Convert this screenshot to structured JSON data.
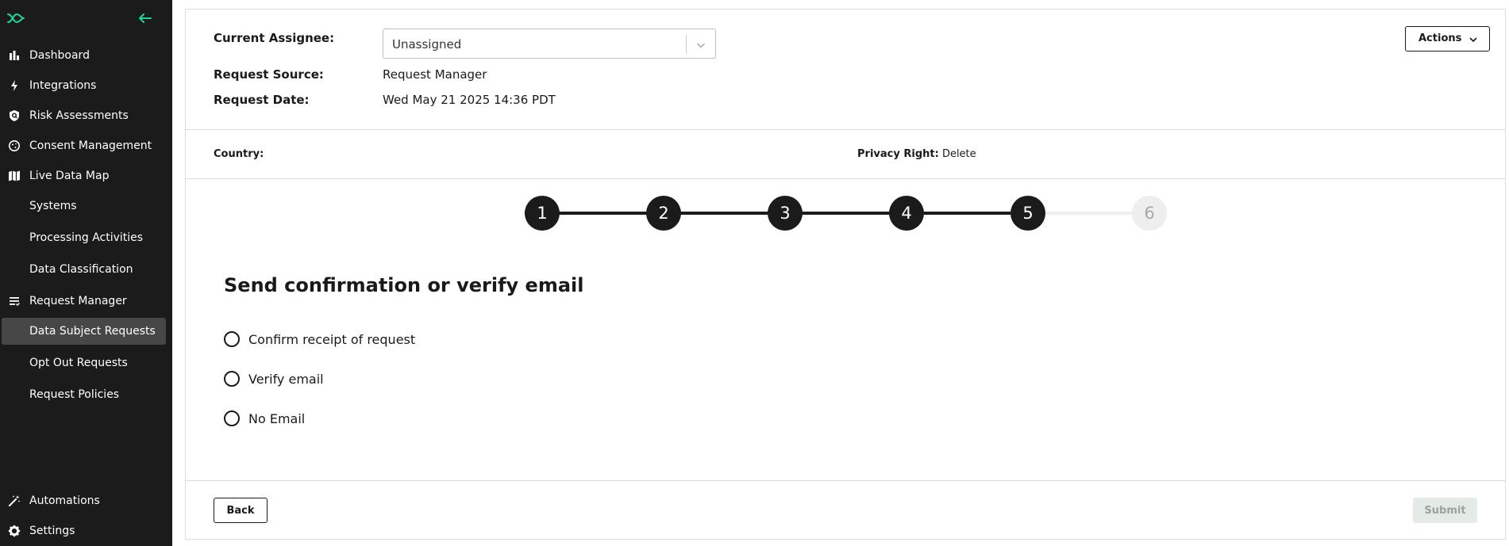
{
  "colors": {
    "accent": "#1fd49a",
    "sidebar_bg": "#1b1b1b",
    "active_bg": "#474747",
    "step_active": "#1b1b1b",
    "step_inactive": "#eeeeee",
    "submit_disabled_bg": "#e4ebe7"
  },
  "sidebar": {
    "logo_icon": "app-logo-icon",
    "collapse_icon": "arrow-left-icon",
    "items": [
      {
        "label": "Dashboard",
        "icon": "bar-chart-icon"
      },
      {
        "label": "Integrations",
        "icon": "lightning-icon"
      },
      {
        "label": "Risk Assessments",
        "icon": "shield-search-icon"
      },
      {
        "label": "Consent Management",
        "icon": "cookie-icon"
      },
      {
        "label": "Live Data Map",
        "icon": "map-icon"
      },
      {
        "label": "Systems"
      },
      {
        "label": "Processing Activities"
      },
      {
        "label": "Data Classification"
      },
      {
        "label": "Request Manager",
        "icon": "list-icon"
      },
      {
        "label": "Data Subject Requests",
        "active": true
      },
      {
        "label": "Opt Out Requests"
      },
      {
        "label": "Request Policies"
      },
      {
        "label": "Automations",
        "icon": "magic-wand-icon"
      },
      {
        "label": "Settings",
        "icon": "gear-icon"
      }
    ]
  },
  "header": {
    "assignee_label": "Current Assignee:",
    "assignee_value": "Unassigned",
    "source_label": "Request Source:",
    "source_value": "Request Manager",
    "date_label": "Request Date:",
    "date_value": "Wed May 21 2025 14:36 PDT",
    "actions_label": "Actions"
  },
  "meta": {
    "country_label": "Country:",
    "country_value": "",
    "privacy_right_label": "Privacy Right:",
    "privacy_right_value": "Delete"
  },
  "stepper": {
    "steps": [
      "1",
      "2",
      "3",
      "4",
      "5",
      "6"
    ],
    "completed_through": 5
  },
  "step_form": {
    "title": "Send confirmation or verify email",
    "options": [
      "Confirm receipt of request",
      "Verify email",
      "No Email"
    ],
    "selected": null
  },
  "footer": {
    "back_label": "Back",
    "submit_label": "Submit",
    "submit_enabled": false
  }
}
